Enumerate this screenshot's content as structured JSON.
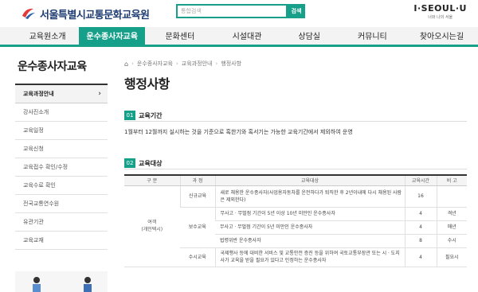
{
  "header": {
    "logo_text": "서울특별시교통문화교육원",
    "search_placeholder": "통합검색",
    "search_button": "검색",
    "seoul_brand": "I·SEOUL·U",
    "seoul_sub": "너와 나의 서울"
  },
  "gnb": {
    "items": [
      {
        "label": "교육원소개"
      },
      {
        "label": "운수종사자교육",
        "active": true
      },
      {
        "label": "문화센터"
      },
      {
        "label": "시설대관"
      },
      {
        "label": "상담실"
      },
      {
        "label": "커뮤니티"
      },
      {
        "label": "찾아오시는길"
      }
    ]
  },
  "lnb": {
    "title": "운수종사자교육",
    "items": [
      {
        "label": "교육과정안내",
        "current": true
      },
      {
        "label": "강사진소개"
      },
      {
        "label": "교육일정"
      },
      {
        "label": "교육신청"
      },
      {
        "label": "교육접수 확인/수정"
      },
      {
        "label": "교육수료 확인"
      },
      {
        "label": "전국교통연수원"
      },
      {
        "label": "유관기관"
      },
      {
        "label": "교육교재"
      }
    ]
  },
  "breadcrumb": [
    "운수종사자교육",
    "교육과정안내",
    "행정사항"
  ],
  "page_title": "행정사항",
  "section1": {
    "num": "01",
    "title": "교육기간",
    "text": "1월부터 12월까지 실시하는 것을 기준으로 혹한기와 혹서기는 가능한 교육기간에서 제외하여 운영"
  },
  "section2": {
    "num": "02",
    "title": "교육대상"
  },
  "table": {
    "headers": [
      "구 분",
      "과 정",
      "교육대상",
      "교육시간",
      "비 고"
    ],
    "group_label": "여객\n(개인택시)",
    "rows": [
      {
        "course": "신규교육",
        "target": "새로 채용한 운수종사자(사업용자동차를 운전하다가 퇴직한 후 2년이내에 다시 채용된 사람은 제외한다)",
        "hours": "16",
        "note": ""
      },
      {
        "course": "보수교육",
        "target": "무사고ㆍ무벌점 기간이 5년 이상 10년 미만인 운수종사자",
        "hours": "4",
        "note": "격년"
      },
      {
        "course": "",
        "target": "무사고ㆍ무벌점 기간이 5년 미만인 운수종사자",
        "hours": "4",
        "note": "매년"
      },
      {
        "course": "",
        "target": "법령위반 운수종사자",
        "hours": "8",
        "note": "수시"
      },
      {
        "course": "수시교육",
        "target": "국제행사 등에 대비한 서비스 및 교통안전 증진 등을 위하여 국토교통부장관 또는 시ㆍ도지사가 교육을 받을 필요가 있다고 인정하는 운수종사자",
        "hours": "4",
        "note": "필요시"
      }
    ]
  },
  "colors": {
    "accent": "#16a089",
    "navy": "#1f3d73"
  }
}
